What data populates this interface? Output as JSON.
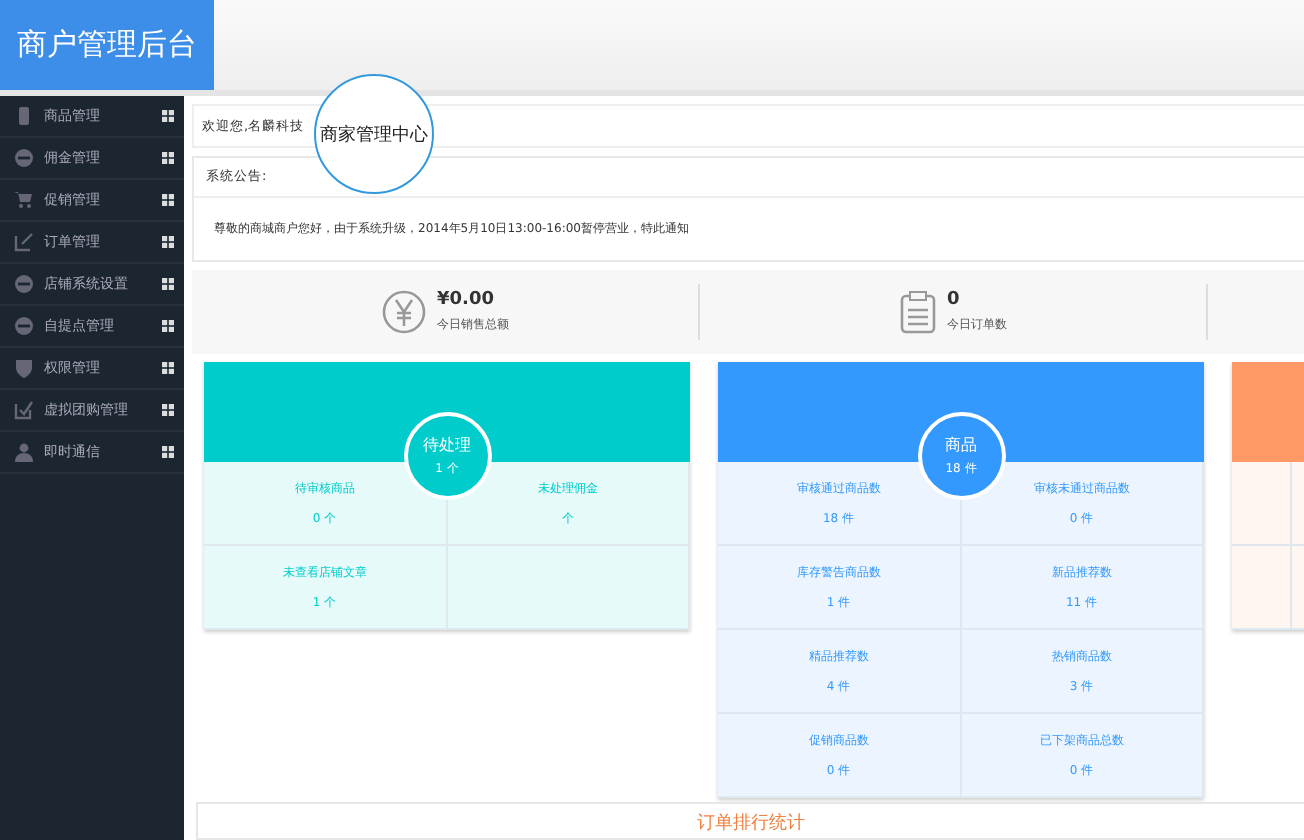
{
  "header": {
    "title": "商户管理后台"
  },
  "sidebar": {
    "items": [
      {
        "label": "商品管理"
      },
      {
        "label": "佣金管理"
      },
      {
        "label": "促销管理"
      },
      {
        "label": "订单管理"
      },
      {
        "label": "店铺系统设置"
      },
      {
        "label": "自提点管理"
      },
      {
        "label": "权限管理"
      },
      {
        "label": "虚拟团购管理"
      },
      {
        "label": "即时通信"
      }
    ]
  },
  "welcome": {
    "text": "欢迎您,名麟科技",
    "callout": "商家管理中心"
  },
  "notice": {
    "title": "系统公告:",
    "message": "尊敬的商城商户您好，由于系统升级，2014年5月10日13:00-16:00暂停营业，特此通知"
  },
  "stats": [
    {
      "value": "¥0.00",
      "label": "今日销售总额"
    },
    {
      "value": "0",
      "label": "今日订单数"
    }
  ],
  "cards": [
    {
      "color": "#00cccc",
      "badge_title": "待处理",
      "badge_count": "1 个",
      "cells": [
        {
          "label": "待审核商品",
          "value": "0 个"
        },
        {
          "label": "未处理佣金",
          "value": "个"
        },
        {
          "label": "未查看店铺文章",
          "value": "1 个"
        }
      ]
    },
    {
      "color": "#3399ff",
      "badge_title": "商品",
      "badge_count": "18 件",
      "cells": [
        {
          "label": "审核通过商品数",
          "value": "18 件"
        },
        {
          "label": "审核未通过商品数",
          "value": "0 件"
        },
        {
          "label": "库存警告商品数",
          "value": "1 件"
        },
        {
          "label": "新品推荐数",
          "value": "11 件"
        },
        {
          "label": "精品推荐数",
          "value": "4 件"
        },
        {
          "label": "热销商品数",
          "value": "3 件"
        },
        {
          "label": "促销商品数",
          "value": "0 件"
        },
        {
          "label": "已下架商品总数",
          "value": "0 件"
        }
      ]
    },
    {
      "color": "#ff9966"
    }
  ],
  "ranking": {
    "title": "订单排行统计"
  }
}
